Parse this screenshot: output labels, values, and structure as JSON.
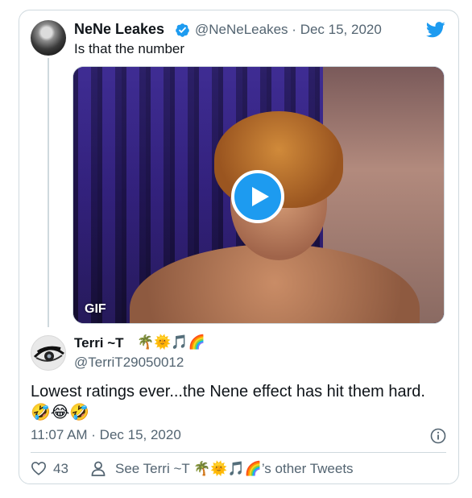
{
  "parent_tweet": {
    "name": "NeNe Leakes",
    "handle": "@NeNeLeakes",
    "date_sep": "·",
    "date": "Dec 15, 2020",
    "text": "Is that the number",
    "media_badge": "GIF"
  },
  "reply_tweet": {
    "name": "Terri ~T",
    "name_emojis": "🌴🌞🎵🌈",
    "handle": "@TerriT29050012",
    "text": "Lowest ratings ever...the Nene effect has hit them hard.",
    "text_emojis": "🤣😂🤣",
    "timestamp": "11:07 AM · Dec 15, 2020"
  },
  "footer": {
    "like_count": "43",
    "see_other": "See Terri ~T 🌴🌞🎵🌈’s other Tweets"
  },
  "icons": {
    "verified": "verified-badge-icon",
    "brand": "twitter-bird-icon",
    "play": "play-icon",
    "info": "info-icon",
    "like": "heart-icon",
    "person": "person-icon"
  },
  "colors": {
    "accent": "#1d9bf0",
    "text": "#0f1419",
    "secondary": "#536471",
    "border": "#cfd9de"
  }
}
